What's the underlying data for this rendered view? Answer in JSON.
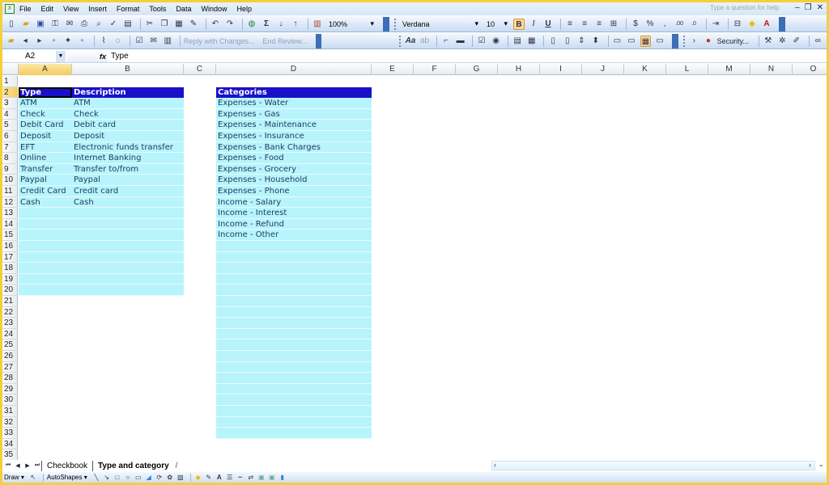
{
  "menubar": {
    "app_icon": "excel-icon",
    "items": [
      "File",
      "Edit",
      "View",
      "Insert",
      "Format",
      "Tools",
      "Data",
      "Window",
      "Help"
    ],
    "help_placeholder": "Type a question for help",
    "window_controls": [
      "–",
      "❐",
      "✕"
    ]
  },
  "standard_toolbar": {
    "zoom": "100%",
    "icons": [
      "new-icon",
      "open-icon",
      "save-icon",
      "permission-icon",
      "email-icon",
      "print-icon",
      "print-preview-icon",
      "spelling-icon",
      "research-icon",
      "cut-icon",
      "copy-icon",
      "paste-icon",
      "format-painter-icon",
      "undo-icon",
      "redo-icon",
      "hyperlink-icon",
      "autosum-icon",
      "sort-ascending-icon",
      "sort-descending-icon",
      "chart-wizard-icon"
    ]
  },
  "formatting_toolbar": {
    "font": "Verdana",
    "size": "10",
    "bold": "B",
    "italic": "I",
    "underline": "U",
    "currency": "$",
    "percent": "%",
    "comma": ","
  },
  "reviewing_toolbar": {
    "reply_label": "Reply with Changes...",
    "end_review_label": "End Review..."
  },
  "forms_toolbar": {
    "security_label": "Security..."
  },
  "formula_bar": {
    "name_box": "A2",
    "fx": "fx",
    "formula": "Type"
  },
  "columns": [
    "A",
    "B",
    "C",
    "D",
    "E",
    "F",
    "G",
    "H",
    "I",
    "J",
    "K",
    "L",
    "M",
    "N",
    "O"
  ],
  "active_column": "A",
  "active_row": 2,
  "row_count": 35,
  "table1": {
    "headers": [
      "Type",
      "Description"
    ],
    "rows": [
      [
        "ATM",
        "ATM"
      ],
      [
        "Check",
        "Check"
      ],
      [
        "Debit Card",
        "Debit card"
      ],
      [
        "Deposit",
        "Deposit"
      ],
      [
        "EFT",
        "Electronic funds transfer"
      ],
      [
        "Online",
        "Internet Banking"
      ],
      [
        "Transfer",
        "Transfer to/from"
      ],
      [
        "Paypal",
        "Paypal"
      ],
      [
        "Credit Card",
        "Credit card"
      ],
      [
        "Cash",
        "Cash"
      ]
    ],
    "filled_through_row": 20
  },
  "table2": {
    "header": "Categories",
    "items": [
      "Expenses - Water",
      "Expenses - Gas",
      "Expenses - Maintenance",
      "Expenses - Insurance",
      "Expenses - Bank Charges",
      "Expenses - Food",
      "Expenses - Grocery",
      "Expenses - Household",
      "Expenses - Phone",
      "Income - Salary",
      "Income - Interest",
      "Income - Refund",
      "Income - Other"
    ],
    "filled_through_row": 33
  },
  "colors": {
    "header_fill": "#1a10c8",
    "band_fill": "#b8f4fb",
    "frame": "#f3cf3a"
  },
  "sheet_tabs": [
    "Checkbook",
    "Type and category"
  ],
  "active_sheet": "Type and category",
  "draw_toolbar": {
    "draw_label": "Draw ▾",
    "autoshapes_label": "AutoShapes ▾"
  }
}
